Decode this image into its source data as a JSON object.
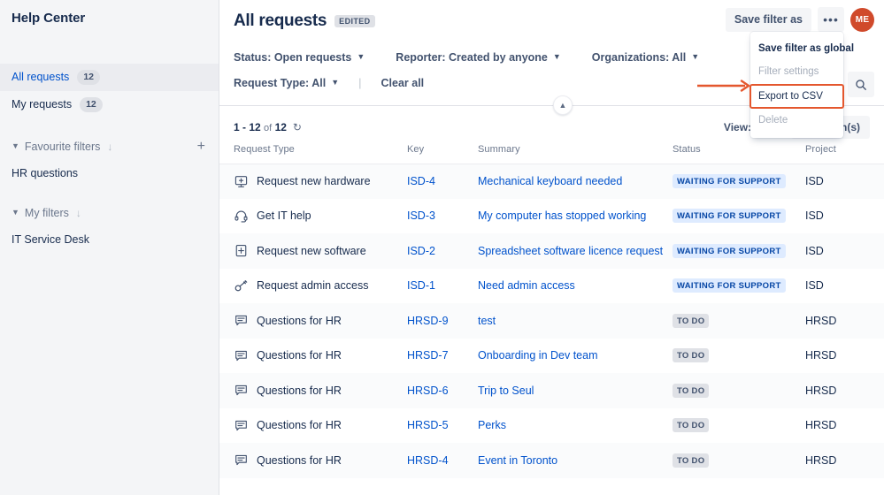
{
  "sidebar": {
    "title": "Help Center",
    "nav": [
      {
        "label": "All requests",
        "count": "12",
        "active": true
      },
      {
        "label": "My requests",
        "count": "12",
        "active": false
      }
    ],
    "sections": [
      {
        "label": "Favourite filters",
        "items": [
          "HR questions"
        ],
        "has_add": true
      },
      {
        "label": "My filters",
        "items": [
          "IT Service Desk"
        ],
        "has_add": false
      }
    ]
  },
  "header": {
    "title": "All requests",
    "edited_badge": "EDITED",
    "save_filter_as": "Save filter as",
    "more_label": "•••",
    "avatar_initials": "ME"
  },
  "menu": {
    "items": [
      {
        "label": "Save filter as global",
        "state": "normal"
      },
      {
        "label": "Filter settings",
        "state": "disabled"
      },
      {
        "label": "Export to CSV",
        "state": "highlight"
      },
      {
        "label": "Delete",
        "state": "disabled"
      }
    ],
    "highlight_color": "#e4572e"
  },
  "filters": {
    "row1": [
      {
        "label": "Status: Open requests"
      },
      {
        "label": "Reporter: Created by anyone"
      },
      {
        "label": "Organizations: All"
      }
    ],
    "row2": [
      {
        "label": "Request Type: All"
      }
    ],
    "separator": "|",
    "clear_all": "Clear all"
  },
  "results": {
    "range": "1 - 12",
    "of": "of",
    "total": "12",
    "view_label": "View: 25",
    "columns_button": "5 column(s)"
  },
  "table": {
    "headers": [
      "Request Type",
      "Key",
      "Summary",
      "Status",
      "Project"
    ],
    "rows": [
      {
        "type": "Request new hardware",
        "icon": "monitor-plus-icon",
        "key": "ISD-4",
        "summary": "Mechanical keyboard needed",
        "status": "WAITING FOR SUPPORT",
        "status_tone": "blue",
        "project": "ISD"
      },
      {
        "type": "Get IT help",
        "icon": "headset-icon",
        "key": "ISD-3",
        "summary": "My computer has stopped working",
        "status": "WAITING FOR SUPPORT",
        "status_tone": "blue",
        "project": "ISD"
      },
      {
        "type": "Request new software",
        "icon": "square-plus-icon",
        "key": "ISD-2",
        "summary": "Spreadsheet software licence request",
        "status": "WAITING FOR SUPPORT",
        "status_tone": "blue",
        "project": "ISD"
      },
      {
        "type": "Request admin access",
        "icon": "key-icon",
        "key": "ISD-1",
        "summary": "Need admin access",
        "status": "WAITING FOR SUPPORT",
        "status_tone": "blue",
        "project": "ISD"
      },
      {
        "type": "Questions for HR",
        "icon": "comment-lines-icon",
        "key": "HRSD-9",
        "summary": "test",
        "status": "TO DO",
        "status_tone": "grey",
        "project": "HRSD"
      },
      {
        "type": "Questions for HR",
        "icon": "comment-lines-icon",
        "key": "HRSD-7",
        "summary": "Onboarding in Dev team",
        "status": "TO DO",
        "status_tone": "grey",
        "project": "HRSD"
      },
      {
        "type": "Questions for HR",
        "icon": "comment-lines-icon",
        "key": "HRSD-6",
        "summary": "Trip to Seul",
        "status": "TO DO",
        "status_tone": "grey",
        "project": "HRSD"
      },
      {
        "type": "Questions for HR",
        "icon": "comment-lines-icon",
        "key": "HRSD-5",
        "summary": "Perks",
        "status": "TO DO",
        "status_tone": "grey",
        "project": "HRSD"
      },
      {
        "type": "Questions for HR",
        "icon": "comment-lines-icon",
        "key": "HRSD-4",
        "summary": "Event in Toronto",
        "status": "TO DO",
        "status_tone": "grey",
        "project": "HRSD"
      }
    ]
  },
  "colors": {
    "link": "#0052cc",
    "text": "#172b4d",
    "muted": "#6b778c",
    "sidebar_bg": "#f4f5f7",
    "avatar_bg": "#d04a2b",
    "badge_blue_bg": "#deebff",
    "badge_grey_bg": "#dfe1e6",
    "annotation": "#e4572e"
  }
}
